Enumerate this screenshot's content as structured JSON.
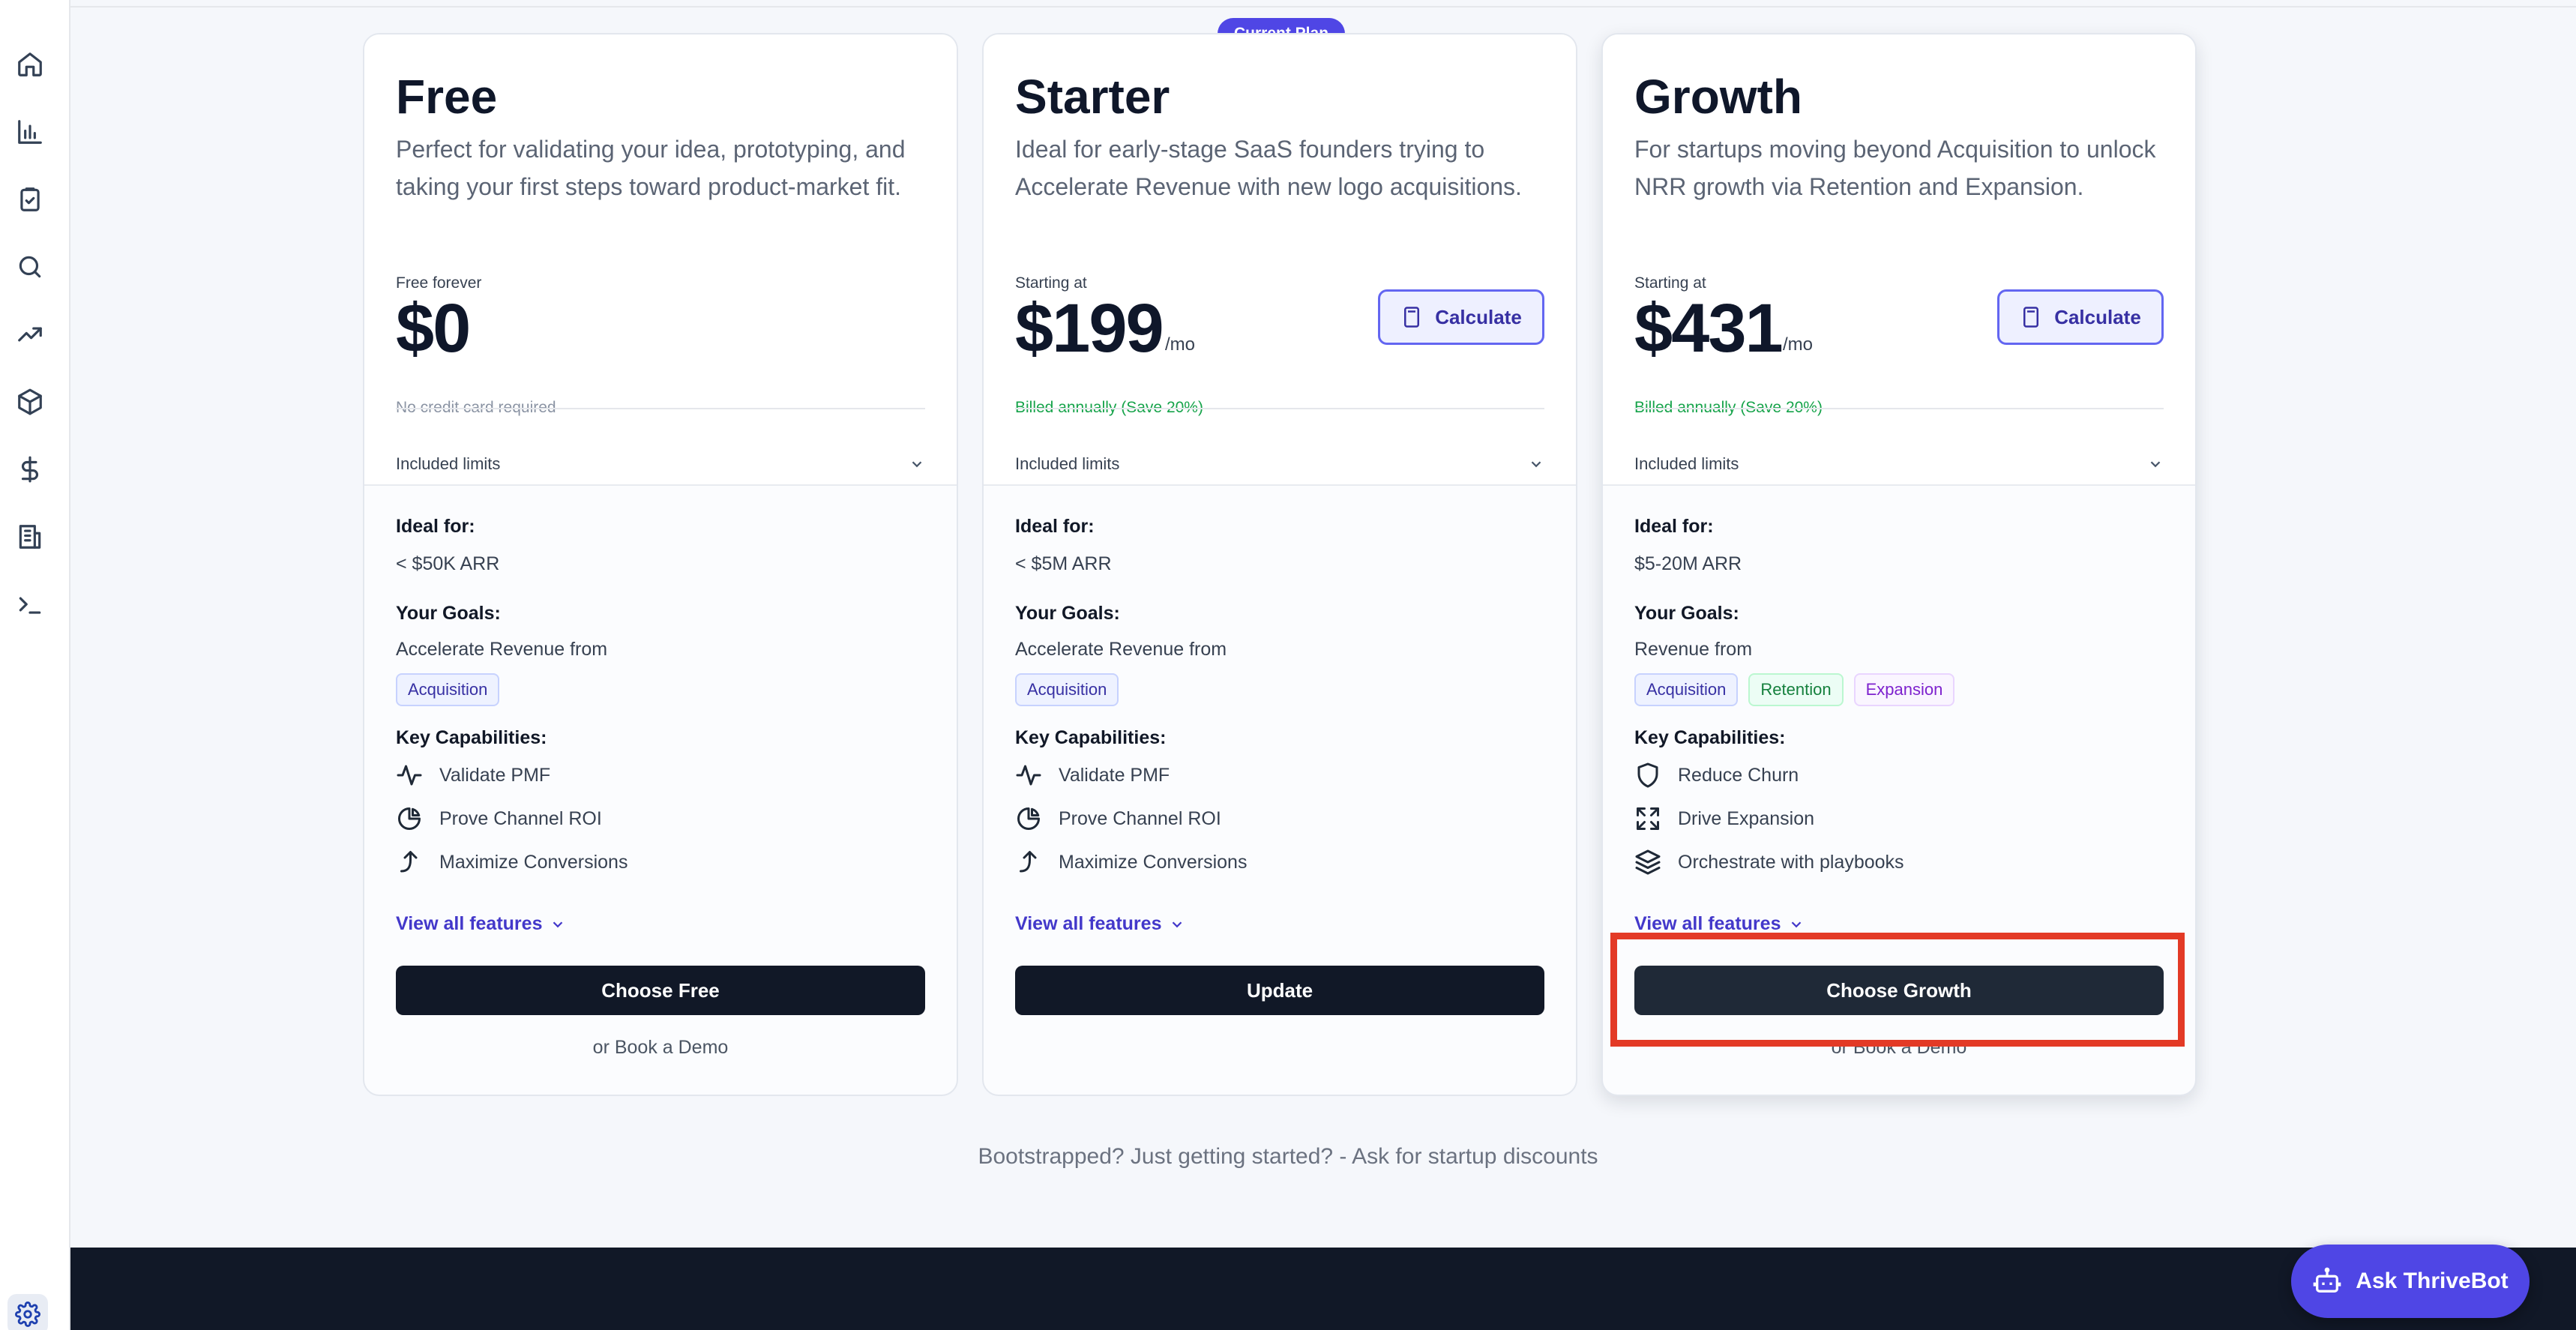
{
  "sidebar": {
    "icons": [
      "home-icon",
      "bar-chart-icon",
      "clipboard-check-icon",
      "search-icon",
      "trending-up-icon",
      "package-icon",
      "dollar-icon",
      "building-icon",
      "terminal-icon"
    ],
    "settings_icon": "gear-icon"
  },
  "plans": [
    {
      "name": "Free",
      "description": "Perfect for validating your idea, prototyping, and taking your first steps toward product-market fit.",
      "price_caption": "Free forever",
      "price": "$0",
      "per": "",
      "price_note": "No credit card required",
      "limits_label": "Included limits",
      "ideal_label": "Ideal for:",
      "ideal_value": "< $50K ARR",
      "goals_label": "Your Goals:",
      "goals_text": "Accelerate Revenue from",
      "tags": [
        "Acquisition"
      ],
      "caps_label": "Key Capabilities:",
      "capabilities": [
        "Validate PMF",
        "Prove Channel ROI",
        "Maximize Conversions"
      ],
      "view_all": "View all features",
      "button": "Choose Free",
      "demo": "or Book a Demo"
    },
    {
      "name": "Starter",
      "description": "Ideal for early-stage SaaS founders trying to Accelerate Revenue with new logo acquisitions.",
      "price_caption": "Starting at",
      "price": "$199",
      "per": "/mo",
      "price_note": "Billed annually (Save 20%)",
      "calculate": "Calculate",
      "limits_label": "Included limits",
      "ideal_label": "Ideal for:",
      "ideal_value": "< $5M ARR",
      "goals_label": "Your Goals:",
      "goals_text": "Accelerate Revenue from",
      "tags": [
        "Acquisition"
      ],
      "caps_label": "Key Capabilities:",
      "capabilities": [
        "Validate PMF",
        "Prove Channel ROI",
        "Maximize Conversions"
      ],
      "view_all": "View all features",
      "button": "Update",
      "badge": "Current Plan"
    },
    {
      "name": "Growth",
      "description": "For startups moving beyond Acquisition to unlock NRR growth via Retention and Expansion.",
      "price_caption": "Starting at",
      "price": "$431",
      "per": "/mo",
      "price_note": "Billed annually (Save 20%)",
      "calculate": "Calculate",
      "limits_label": "Included limits",
      "ideal_label": "Ideal for:",
      "ideal_value": "$5-20M ARR",
      "goals_label": "Your Goals:",
      "goals_text": "Revenue from",
      "tags": [
        "Acquisition",
        "Retention",
        "Expansion"
      ],
      "caps_label": "Key Capabilities:",
      "capabilities": [
        "Reduce Churn",
        "Drive Expansion",
        "Orchestrate with playbooks"
      ],
      "view_all": "View all features",
      "button": "Choose Growth",
      "demo": "or Book a Demo"
    }
  ],
  "bootstrapped": "Bootstrapped? Just getting started? - Ask for startup discounts",
  "chatbot": {
    "label": "Ask ThriveBot",
    "icon": "bot-icon"
  },
  "colors": {
    "accent": "#4f46e5",
    "highlight": "#e33a26",
    "dark": "#111827"
  }
}
